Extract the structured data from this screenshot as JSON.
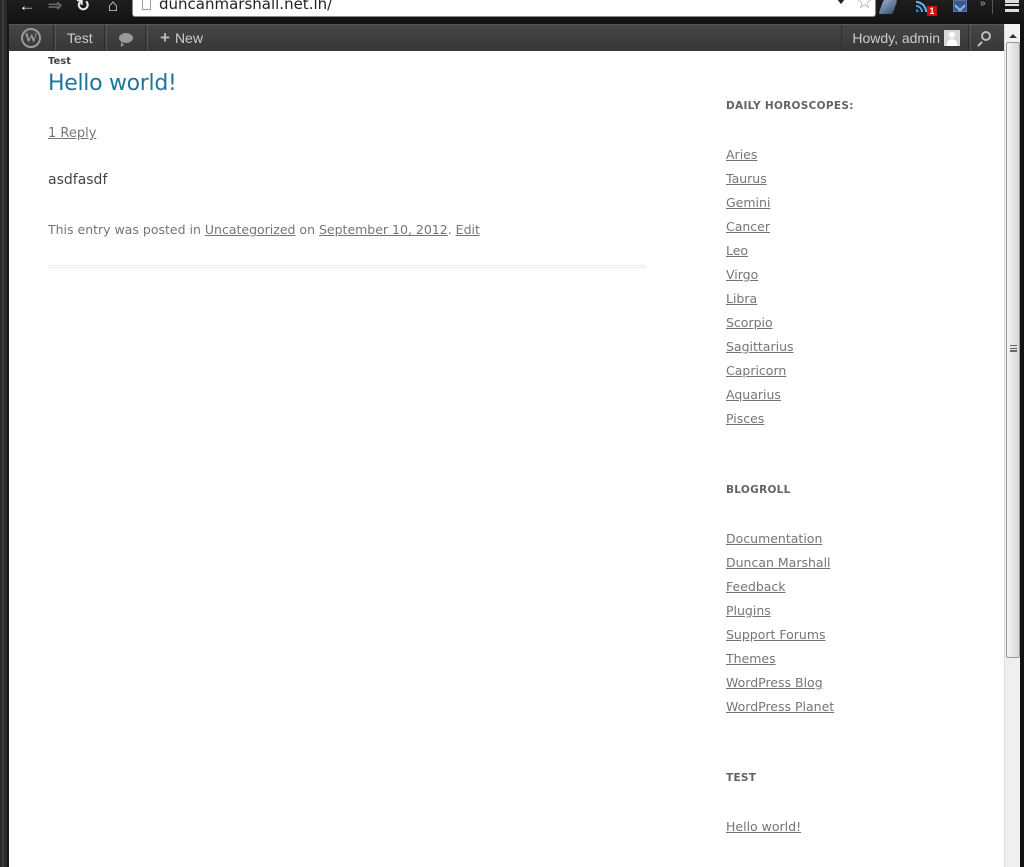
{
  "browser": {
    "url": "duncanmarshall.net.lh/",
    "rss_badge": "1",
    "more_label": "»"
  },
  "admin_bar": {
    "site_name": "Test",
    "new_label": "New",
    "account_label": "Howdy, admin"
  },
  "post": {
    "category_label": "Test",
    "title": "Hello world!",
    "reply_link": "1 Reply",
    "body": "asdfasdf",
    "meta": {
      "prefix": "This entry was posted in ",
      "category": "Uncategorized",
      "on": " on ",
      "date": "September 10, 2012",
      "period": ". ",
      "edit": "Edit"
    }
  },
  "sidebar": {
    "widgets": [
      {
        "title": "DAILY HOROSCOPES:",
        "items": [
          "Aries",
          "Taurus",
          "Gemini",
          "Cancer",
          "Leo",
          "Virgo",
          "Libra",
          "Scorpio",
          "Sagittarius",
          "Capricorn",
          "Aquarius",
          "Pisces"
        ]
      },
      {
        "title": "BLOGROLL",
        "items": [
          "Documentation",
          "Duncan Marshall",
          "Feedback",
          "Plugins",
          "Support Forums",
          "Themes",
          "WordPress Blog",
          "WordPress Planet"
        ]
      },
      {
        "title": "TEST",
        "items": [
          "Hello world!"
        ]
      }
    ]
  },
  "colors": {
    "title_link": "#21759b",
    "admin_bar": "#464646",
    "meta_text": "#757575"
  }
}
